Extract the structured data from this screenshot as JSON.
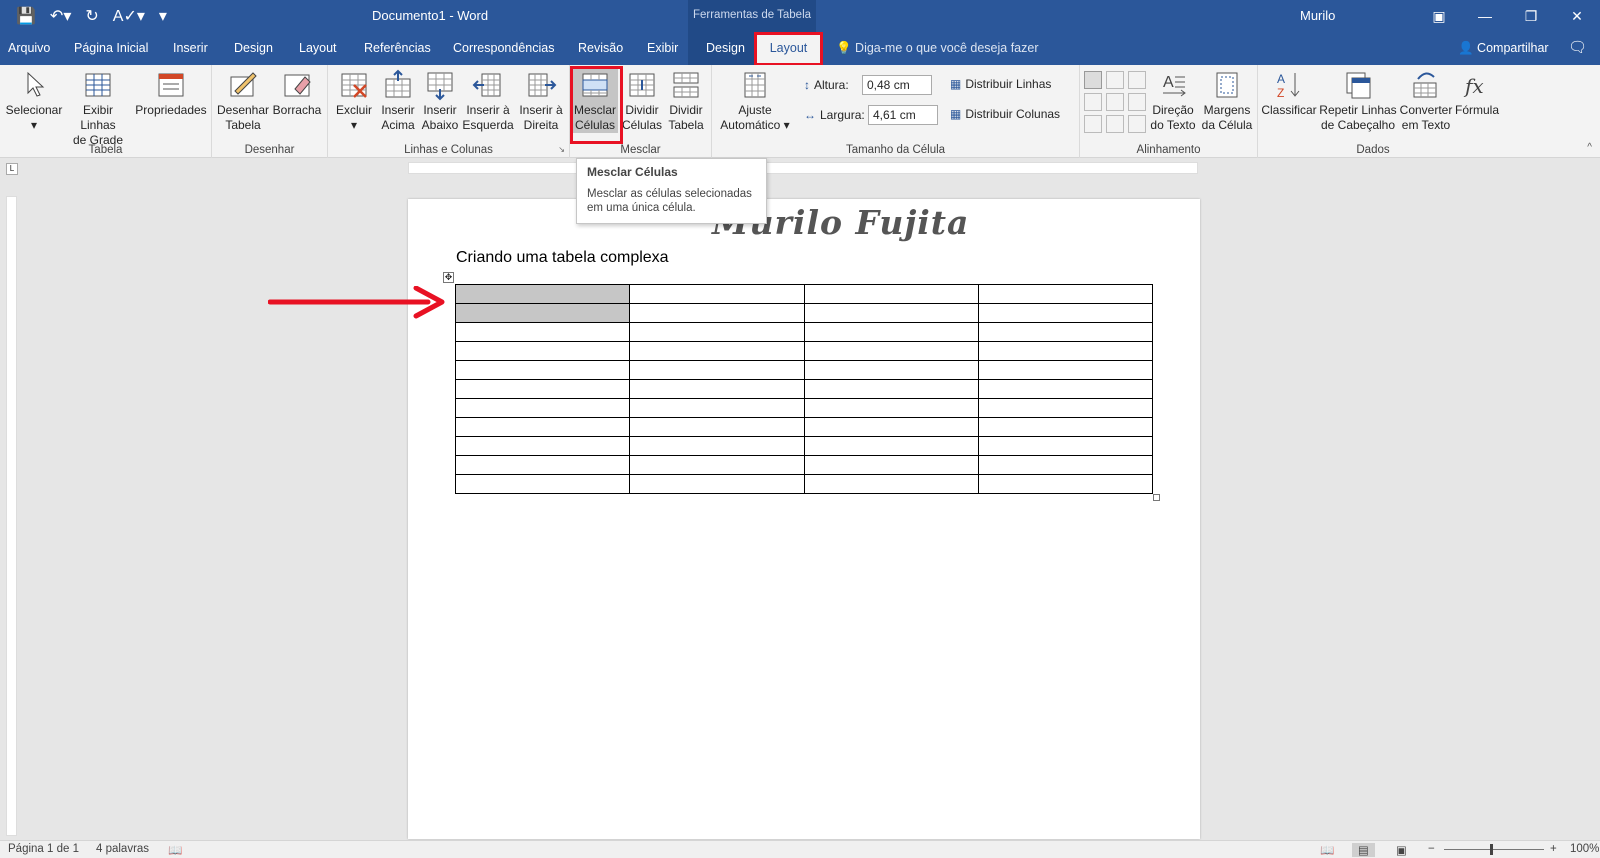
{
  "window": {
    "title": "Documento1 - Word",
    "context_title": "Ferramentas de Tabela",
    "user": "Murilo"
  },
  "tabs": [
    "Arquivo",
    "Página Inicial",
    "Inserir",
    "Design",
    "Layout",
    "Referências",
    "Correspondências",
    "Revisão",
    "Exibir",
    "Design",
    "Layout"
  ],
  "tell_me": "Diga-me o que você deseja fazer",
  "share": "Compartilhar",
  "ribbon": {
    "tabela": {
      "label": "Tabela",
      "selecionar": "Selecionar",
      "linhas_grade_1": "Exibir Linhas",
      "linhas_grade_2": "de Grade",
      "propriedades": "Propriedades"
    },
    "desenhar": {
      "label": "Desenhar",
      "desenhar_1": "Desenhar",
      "desenhar_2": "Tabela",
      "borracha": "Borracha"
    },
    "linhas_colunas": {
      "label": "Linhas e Colunas",
      "excluir": "Excluir",
      "acima_1": "Inserir",
      "acima_2": "Acima",
      "abaixo_1": "Inserir",
      "abaixo_2": "Abaixo",
      "esquerda_1": "Inserir à",
      "esquerda_2": "Esquerda",
      "direita_1": "Inserir à",
      "direita_2": "Direita"
    },
    "mesclar": {
      "label": "Mesclar",
      "mesclar_1": "Mesclar",
      "mesclar_2": "Células",
      "dividir_cel_1": "Dividir",
      "dividir_cel_2": "Células",
      "dividir_tab_1": "Dividir",
      "dividir_tab_2": "Tabela"
    },
    "tamanho": {
      "label": "Tamanho da Célula",
      "ajuste_1": "Ajuste",
      "ajuste_2": "Automático",
      "altura_label": "Altura:",
      "altura_value": "0,48 cm",
      "largura_label": "Largura:",
      "largura_value": "4,61 cm",
      "dist_linhas": "Distribuir Linhas",
      "dist_colunas": "Distribuir Colunas"
    },
    "alinhamento": {
      "label": "Alinhamento",
      "direcao_1": "Direção",
      "direcao_2": "do Texto",
      "margens_1": "Margens",
      "margens_2": "da Célula"
    },
    "dados": {
      "label": "Dados",
      "classificar": "Classificar",
      "repetir_1": "Repetir Linhas",
      "repetir_2": "de Cabeçalho",
      "converter_1": "Converter",
      "converter_2": "em Texto",
      "formula": "Fórmula"
    }
  },
  "tooltip": {
    "title": "Mesclar Células",
    "body": "Mesclar as células selecionadas em uma única célula."
  },
  "document": {
    "watermark": "Murilo Fujita",
    "heading": "Criando uma tabela complexa",
    "rows": 11,
    "cols": 4
  },
  "status": {
    "page": "Página 1 de 1",
    "words": "4 palavras",
    "zoom": "100%"
  },
  "colors": {
    "accent": "#2b579a",
    "highlight": "#e81123",
    "selection": "#c6c6c6"
  }
}
